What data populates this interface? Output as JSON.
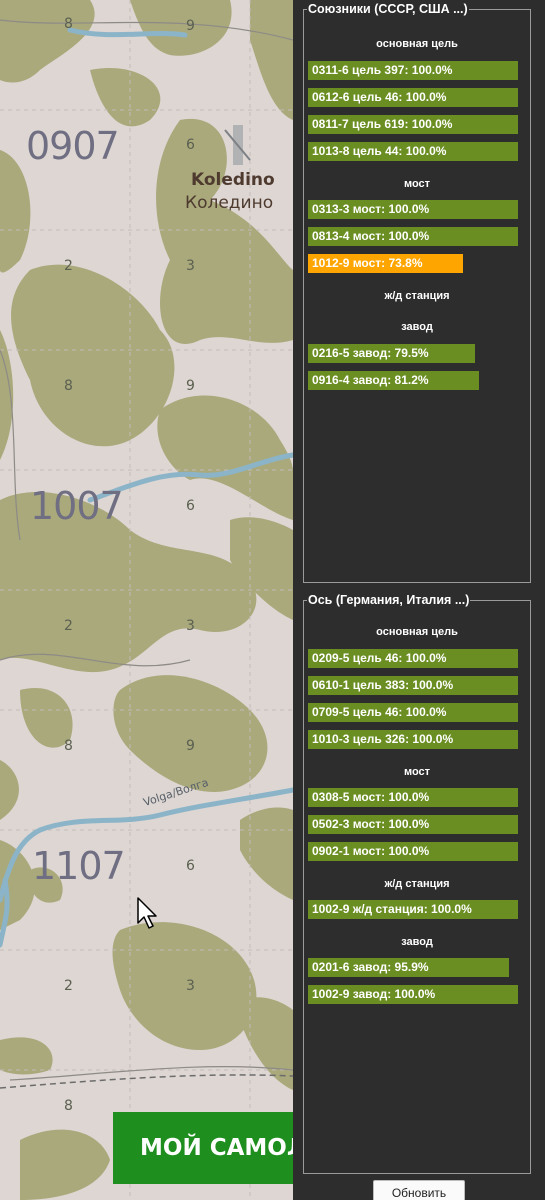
{
  "map": {
    "square_labels": [
      "0907",
      "1007",
      "1107"
    ],
    "city_latin": "Koledino",
    "city_cyrillic": "Коледино",
    "river_label": "Volga/Волга",
    "grid_numbers": {
      "g1": "8",
      "g2": "9",
      "g3": "6",
      "g4": "2",
      "g5": "3",
      "g6": "8",
      "g7": "9",
      "g8": "6",
      "g9": "2",
      "g10": "3",
      "g11": "8",
      "g12": "9",
      "g13": "6",
      "g14": "2",
      "g15": "3",
      "g16": "8"
    },
    "my_plane_button": "МОЙ САМОЛЕТ",
    "colors": {
      "forest": "#a9a97c",
      "snow": "#ddd6d2",
      "river": "#8cb4c8"
    }
  },
  "panel": {
    "allies": {
      "title": "Союзники (СССР, США ...)",
      "categories": {
        "primary": "основная цель",
        "bridge": "мост",
        "rail": "ж/д станция",
        "factory": "завод"
      },
      "targets": [
        {
          "label": "0311-6 цель 397: 100.0%",
          "percent": 100.0
        },
        {
          "label": "0612-6 цель 46: 100.0%",
          "percent": 100.0
        },
        {
          "label": "0811-7 цель 619: 100.0%",
          "percent": 100.0
        },
        {
          "label": "1013-8 цель 44: 100.0%",
          "percent": 100.0
        },
        {
          "label": "0313-3 мост: 100.0%",
          "percent": 100.0
        },
        {
          "label": "0813-4 мост: 100.0%",
          "percent": 100.0
        },
        {
          "label": "1012-9 мост: 73.8%",
          "percent": 73.8
        },
        {
          "label": "0216-5 завод: 79.5%",
          "percent": 79.5
        },
        {
          "label": "0916-4 завод: 81.2%",
          "percent": 81.2
        }
      ]
    },
    "axis": {
      "title": "Ось (Германия, Италия ...)",
      "categories": {
        "primary": "основная цель",
        "bridge": "мост",
        "rail": "ж/д станция",
        "factory": "завод"
      },
      "targets": [
        {
          "label": "0209-5 цель 46: 100.0%",
          "percent": 100.0
        },
        {
          "label": "0610-1 цель 383: 100.0%",
          "percent": 100.0
        },
        {
          "label": "0709-5 цель 46: 100.0%",
          "percent": 100.0
        },
        {
          "label": "1010-3 цель 326: 100.0%",
          "percent": 100.0
        },
        {
          "label": "0308-5 мост: 100.0%",
          "percent": 100.0
        },
        {
          "label": "0502-3 мост: 100.0%",
          "percent": 100.0
        },
        {
          "label": "0902-1 мост: 100.0%",
          "percent": 100.0
        },
        {
          "label": "1002-9 ж/д станция: 100.0%",
          "percent": 100.0
        },
        {
          "label": "0201-6 завод: 95.9%",
          "percent": 95.9
        },
        {
          "label": "1002-9 завод: 100.0%",
          "percent": 100.0
        }
      ]
    },
    "colors": {
      "complete": "#6b8e23",
      "damaged": "#ffa500",
      "background": "#2d2d2d"
    },
    "refresh_button": "Обновить"
  }
}
